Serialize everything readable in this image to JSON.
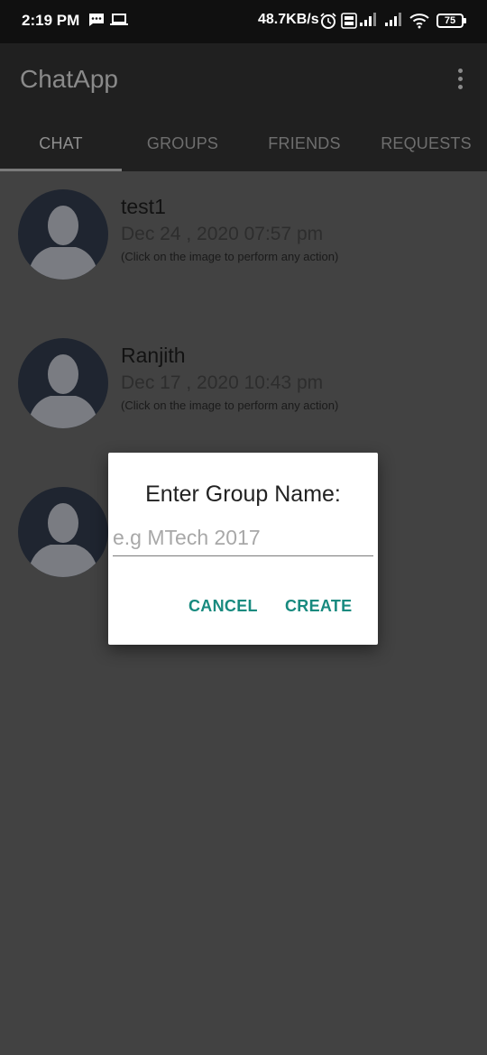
{
  "status_bar": {
    "time": "2:19 PM",
    "net_speed": "48.7KB/s",
    "battery": "75",
    "icons": [
      "message-icon",
      "laptop-icon",
      "alarm-icon",
      "volte-icon",
      "signal-icon",
      "signal-icon",
      "wifi-icon",
      "battery-icon"
    ]
  },
  "app_bar": {
    "title": "ChatApp",
    "menu_icon": "more-vert-icon"
  },
  "tabs": [
    {
      "label": "CHAT",
      "active": true
    },
    {
      "label": "GROUPS",
      "active": false
    },
    {
      "label": "FRIENDS",
      "active": false
    },
    {
      "label": "REQUESTS",
      "active": false
    }
  ],
  "chats": [
    {
      "name": "test1",
      "date": "Dec 24 , 2020 07:57 pm",
      "hint": "(Click on the image to perform any action)"
    },
    {
      "name": "Ranjith",
      "date": "Dec 17 , 2020 10:43 pm",
      "hint": "(Click on the image to perform any action)"
    },
    {
      "name": "",
      "date": "",
      "hint": ""
    }
  ],
  "dialog": {
    "title": "Enter Group Name:",
    "input_value": "",
    "input_placeholder": "e.g MTech 2017",
    "cancel_label": "CANCEL",
    "create_label": "CREATE"
  },
  "colors": {
    "background": "#424242",
    "app_bar": "#202020",
    "status_bar": "#101010",
    "accent": "#188a7f",
    "avatar_bg": "#1f2530"
  }
}
